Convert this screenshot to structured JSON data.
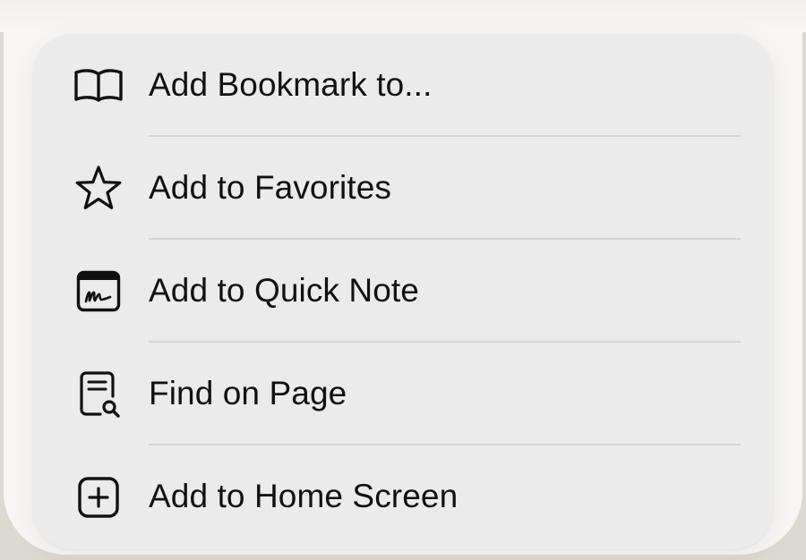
{
  "menu": {
    "items": [
      {
        "label": "Add Bookmark to...",
        "icon": "book-icon"
      },
      {
        "label": "Add to Favorites",
        "icon": "star-icon"
      },
      {
        "label": "Add to Quick Note",
        "icon": "quick-note-icon"
      },
      {
        "label": "Find on Page",
        "icon": "find-on-page-icon"
      },
      {
        "label": "Add to Home Screen",
        "icon": "plus-square-icon"
      }
    ]
  },
  "colors": {
    "menu_background": "#ebebeb",
    "page_background": "#f7f6f4",
    "text": "#111111",
    "divider": "#d3d3d3"
  }
}
